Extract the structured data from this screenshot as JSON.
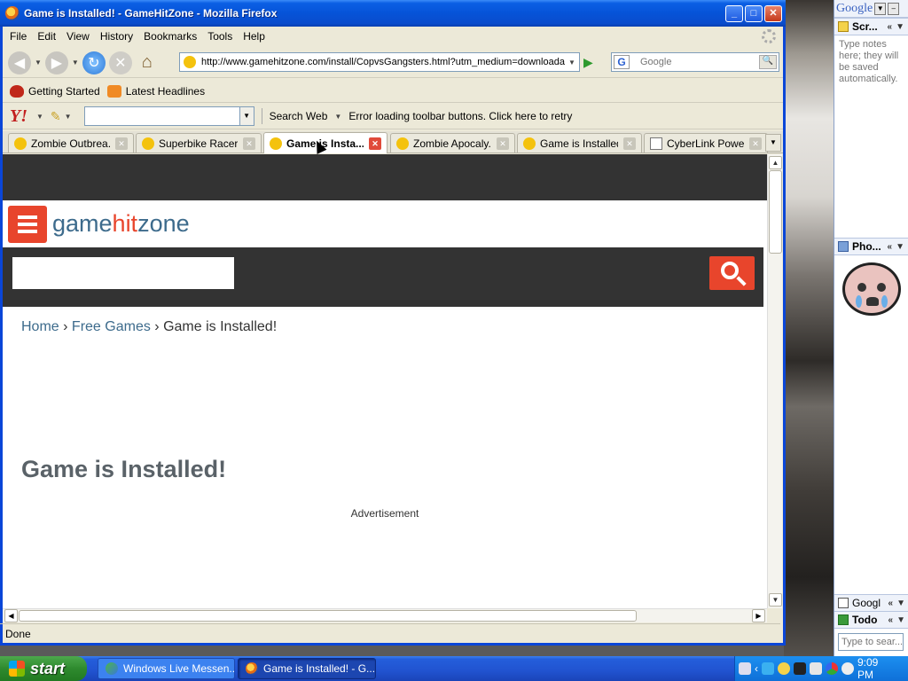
{
  "window": {
    "title": "Game is Installed! - GameHitZone - Mozilla Firefox",
    "minimize": "_",
    "maximize": "□",
    "close": "✕"
  },
  "menu": [
    "File",
    "Edit",
    "View",
    "History",
    "Bookmarks",
    "Tools",
    "Help"
  ],
  "nav": {
    "url": "http://www.gamehitzone.com/install/CopvsGangsters.html?utm_medium=downloadab",
    "google_placeholder": "Google",
    "google_logo": "G"
  },
  "bookmarks": [
    {
      "label": "Getting Started",
      "icon": "getting-started-icon"
    },
    {
      "label": "Latest Headlines",
      "icon": "rss-feed-icon"
    }
  ],
  "yahoo": {
    "logo": "Y!",
    "search_label": "Search Web",
    "error_text": "Error loading toolbar buttons. Click here to retry"
  },
  "tabs": [
    {
      "label": "Zombie Outbrea...",
      "active": false,
      "icon": "game-favicon"
    },
    {
      "label": "Superbike Racer...",
      "active": false,
      "icon": "game-favicon"
    },
    {
      "label": "Game is Insta...",
      "active": true,
      "icon": "game-favicon"
    },
    {
      "label": "Zombie Apocaly...",
      "active": false,
      "icon": "game-favicon"
    },
    {
      "label": "Game is Installed...",
      "active": false,
      "icon": "game-favicon"
    },
    {
      "label": "CyberLink Power...",
      "active": false,
      "icon": "document-icon"
    }
  ],
  "site": {
    "logo_parts": [
      "game",
      "hit",
      "zone"
    ],
    "breadcrumb": {
      "home": "Home",
      "sep": "›",
      "free_games": "Free Games",
      "current": "Game is Installed!"
    },
    "title": "Game is Installed!",
    "advertisement": "Advertisement"
  },
  "status": "Done",
  "sidebar": {
    "logo": "Google",
    "scratch_title": "Scr...",
    "scratch_text": "Type notes here; they will be saved automatically.",
    "photo_title": "Pho...",
    "gmail_title": "Googl",
    "todo_title": "Todo",
    "search_placeholder": "Type to sear..."
  },
  "taskbar": {
    "start": "start",
    "items": [
      {
        "label": "Windows Live Messen...",
        "icon": "messenger-icon"
      },
      {
        "label": "Game is Installed! - G...",
        "icon": "firefox-icon"
      }
    ],
    "clock": "9:09 PM"
  },
  "colors": {
    "brand_blue": "#3d6b8c",
    "brand_red": "#e8452c",
    "header_dark": "#333333"
  }
}
